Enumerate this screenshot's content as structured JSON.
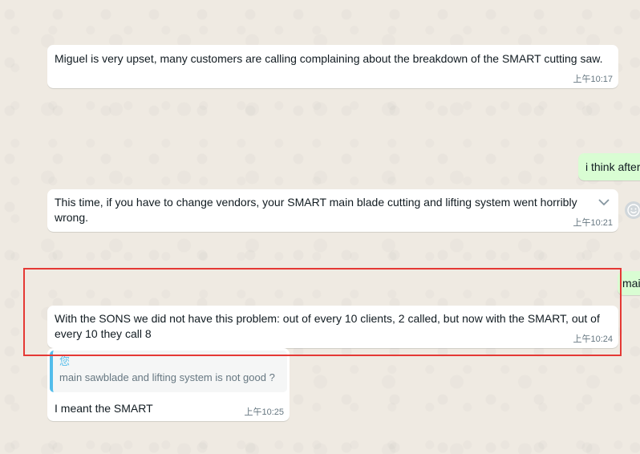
{
  "messages": [
    {
      "text": "Miguel is very upset, many customers are calling complaining about the breakdown of the SMART cutting saw.",
      "time": "上午10:17"
    },
    {
      "text": "i think after"
    },
    {
      "text": "This time, if you have to change vendors, your SMART main blade cutting and lifting system went horribly wrong.",
      "time": "上午10:21"
    },
    {
      "text": "main"
    },
    {
      "text": "With the SONS we did not have this problem: out of every 10 clients, 2 called, but now with the SMART, out of every 10 they call 8",
      "time": "上午10:24"
    },
    {
      "quote_author": "您",
      "quote_text": "main sawblade and lifting system is not good ?",
      "text": "I meant the SMART",
      "time": "上午10:25"
    }
  ],
  "icons": {
    "menu": "chevron-down-icon",
    "reaction": "emoji-icon"
  },
  "colors": {
    "incoming": "#ffffff",
    "outgoing": "#d9fdd3",
    "quote_bar": "#53bdeb",
    "highlight": "#e53935"
  }
}
